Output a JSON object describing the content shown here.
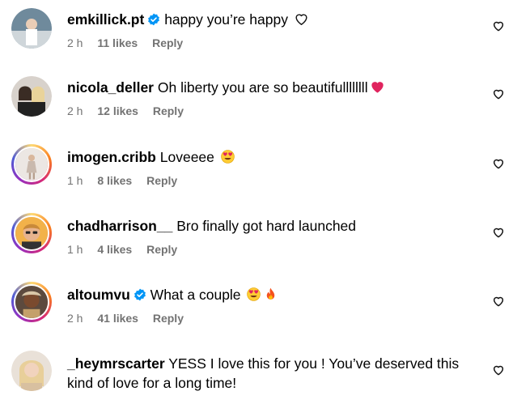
{
  "comments": [
    {
      "username": "emkillick.pt",
      "verified": true,
      "text": "happy you’re happy",
      "trailing_icon": "outline-heart-icon",
      "time": "2 h",
      "likes": "11 likes",
      "reply": "Reply"
    },
    {
      "username": "nicola_deller",
      "verified": false,
      "text": "Oh liberty you are so beautifullllllll",
      "trailing_icon": "red-heart-emoji",
      "time": "2 h",
      "likes": "12 likes",
      "reply": "Reply"
    },
    {
      "username": "imogen.cribb",
      "verified": false,
      "text": "Loveeee",
      "trailing_icon": "heart-eyes-emoji",
      "time": "1 h",
      "likes": "8 likes",
      "reply": "Reply"
    },
    {
      "username": "chadharrison__",
      "verified": false,
      "text": "Bro finally got hard launched",
      "time": "1 h",
      "likes": "4 likes",
      "reply": "Reply"
    },
    {
      "username": "altoumvu",
      "verified": true,
      "text": "What a couple",
      "trailing_icon": "heart-eyes-and-fire-emoji",
      "time": "2 h",
      "likes": "41 likes",
      "reply": "Reply"
    },
    {
      "username": "_heymrscarter",
      "verified": false,
      "text": "YESS I love this for you ! You’ve deserved this kind of love for a long time!"
    }
  ],
  "colors": {
    "meta_gray": "#737373",
    "verified_blue": "#0095f6",
    "heart_red": "#e0245e"
  }
}
